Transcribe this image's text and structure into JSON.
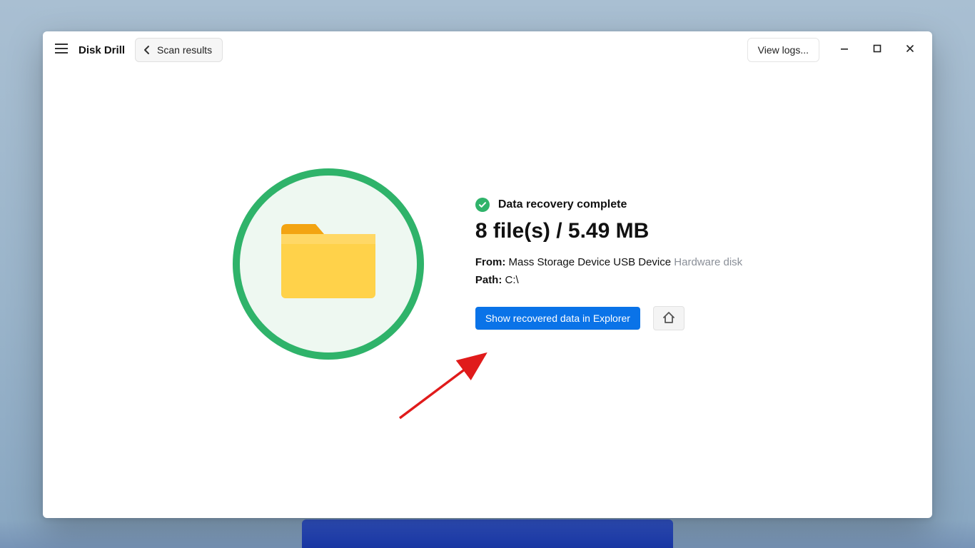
{
  "titlebar": {
    "app_title": "Disk Drill",
    "back_label": "Scan results",
    "view_logs_label": "View logs..."
  },
  "status": {
    "text": "Data recovery complete"
  },
  "summary": {
    "headline": "8 file(s) / 5.49 MB",
    "from_label": "From:",
    "from_value": "Mass Storage Device USB Device",
    "from_value_muted": "Hardware disk",
    "path_label": "Path:",
    "path_value": "C:\\"
  },
  "actions": {
    "primary_label": "Show recovered data in Explorer"
  },
  "icons": {
    "hamburger": "hamburger-icon",
    "chevron_left": "chevron-left-icon",
    "minimize": "minimize-icon",
    "maximize": "maximize-icon",
    "close": "close-icon",
    "folder": "folder-icon",
    "check": "check-icon",
    "home": "home-icon",
    "arrow": "annotation-arrow"
  },
  "colors": {
    "accent_green": "#2fb36a",
    "primary_blue": "#0a73e8",
    "muted_text": "#8a8f98"
  }
}
